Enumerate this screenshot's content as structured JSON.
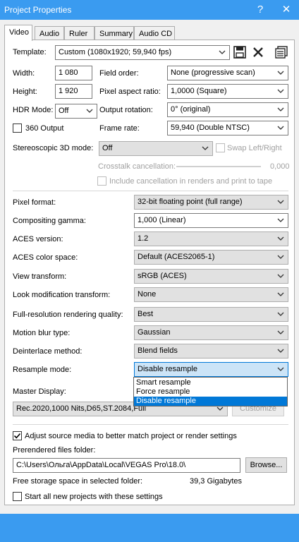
{
  "window": {
    "title": "Project Properties",
    "help_glyph": "?",
    "close_glyph": "✕"
  },
  "tabs": [
    "Video",
    "Audio",
    "Ruler",
    "Summary",
    "Audio CD"
  ],
  "template": {
    "label": "Template:",
    "value": "Custom (1080x1920; 59,940 fps)",
    "icons": [
      "save-icon",
      "delete-icon",
      "match-media-icon"
    ]
  },
  "width": {
    "label": "Width:",
    "value": "1 080"
  },
  "height": {
    "label": "Height:",
    "value": "1 920"
  },
  "field_order": {
    "label": "Field order:",
    "value": "None (progressive scan)"
  },
  "pixel_aspect": {
    "label": "Pixel aspect ratio:",
    "value": "1,0000 (Square)"
  },
  "hdr_mode": {
    "label": "HDR Mode:",
    "value": "Off"
  },
  "output_rotation": {
    "label": "Output rotation:",
    "value": "0° (original)"
  },
  "output_360": {
    "label": "360 Output",
    "checked": false
  },
  "frame_rate": {
    "label": "Frame rate:",
    "value": "59,940 (Double NTSC)"
  },
  "stereo_3d": {
    "label": "Stereoscopic 3D mode:",
    "value": "Off"
  },
  "swap_lr": {
    "label": "Swap Left/Right",
    "checked": false
  },
  "crosstalk": {
    "label": "Crosstalk cancellation:",
    "value": "0,000"
  },
  "include_cancellation": {
    "label": "Include cancellation in renders and print to tape",
    "checked": false
  },
  "pixel_format": {
    "label": "Pixel format:",
    "value": "32-bit floating point (full range)"
  },
  "compositing_gamma": {
    "label": "Compositing gamma:",
    "value": "1,000 (Linear)"
  },
  "aces_version": {
    "label": "ACES version:",
    "value": "1.2"
  },
  "aces_color_space": {
    "label": "ACES color space:",
    "value": "Default (ACES2065-1)"
  },
  "view_transform": {
    "label": "View transform:",
    "value": "sRGB (ACES)"
  },
  "look_mod": {
    "label": "Look modification transform:",
    "value": "None"
  },
  "render_quality": {
    "label": "Full-resolution rendering quality:",
    "value": "Best"
  },
  "motion_blur": {
    "label": "Motion blur type:",
    "value": "Gaussian"
  },
  "deinterlace": {
    "label": "Deinterlace method:",
    "value": "Blend fields"
  },
  "resample": {
    "label": "Resample mode:",
    "value": "Disable resample",
    "options": [
      "Smart resample",
      "Force resample",
      "Disable resample"
    ],
    "highlighted": "Disable resample"
  },
  "master_display": {
    "label": "Master Display:",
    "value": "Rec.2020,1000 Nits,D65,ST.2084,Full",
    "customize_label": "Customize"
  },
  "adjust_source": {
    "label": "Adjust source media to better match project or render settings",
    "checked": true
  },
  "prerendered": {
    "label": "Prerendered files folder:",
    "value": "C:\\Users\\Ольга\\AppData\\Local\\VEGAS Pro\\18.0\\",
    "browse_label": "Browse..."
  },
  "free_space": {
    "label": "Free storage space in selected folder:",
    "value": "39,3 Gigabytes"
  },
  "start_new": {
    "label": "Start all new projects with these settings",
    "checked": false
  },
  "colors": {
    "titlebar": "#3a9bf0",
    "highlight": "#0078d7",
    "selected_combo": "#cce4f7"
  }
}
